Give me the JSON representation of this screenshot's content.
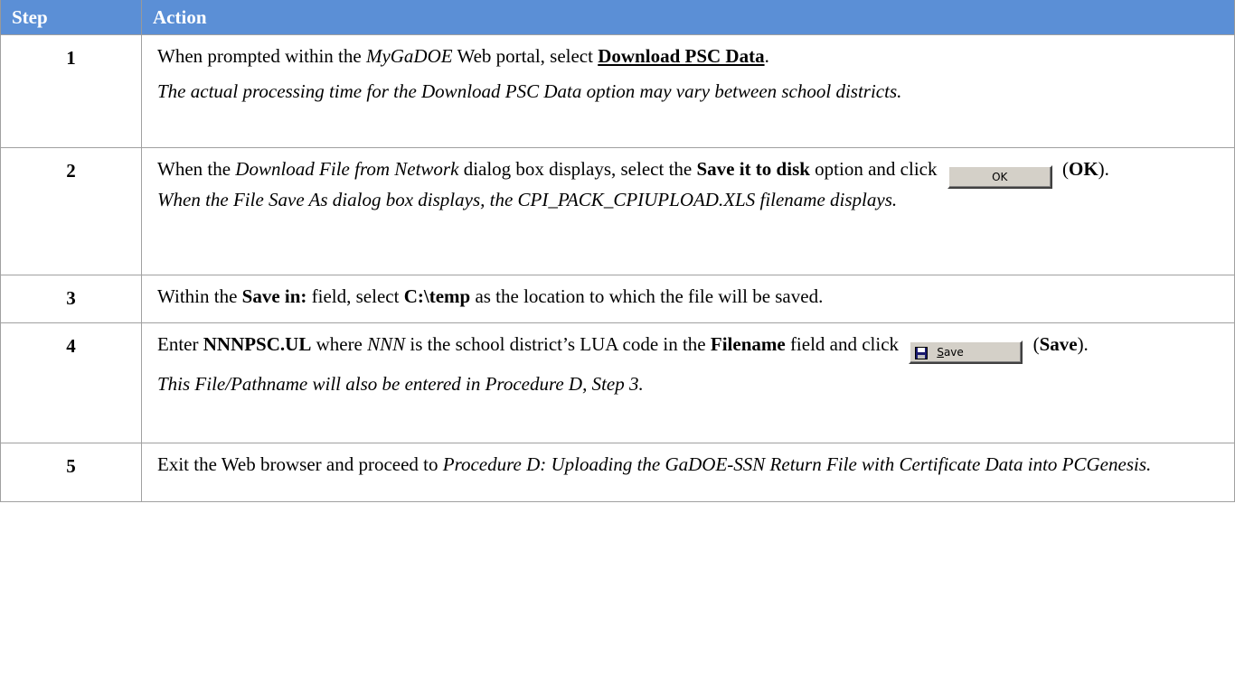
{
  "header": {
    "step": "Step",
    "action": "Action"
  },
  "rows": [
    {
      "num": "1",
      "line1": {
        "a": "When prompted within the ",
        "b": "MyGaDOE",
        "c": " Web portal, select ",
        "d": "Download PSC Data",
        "e": "."
      },
      "note": "The actual processing time for the Download PSC Data option may vary between school districts."
    },
    {
      "num": "2",
      "line1": {
        "a": "When the ",
        "b": "Download File from Network",
        "c": " dialog box displays, select the ",
        "d": "Save it to disk",
        "e": " option and click ",
        "btn": "OK",
        "f": " (",
        "g": "OK",
        "h": ")."
      },
      "note": "When the File Save As dialog box displays, the CPI_PACK_CPIUPLOAD.XLS filename displays."
    },
    {
      "num": "3",
      "line1": {
        "a": "Within the ",
        "b": "Save in:",
        "c": " field, select ",
        "d": "C:\\temp",
        "e": " as the location to which the file will be saved."
      }
    },
    {
      "num": "4",
      "line1": {
        "a": "NNNPSC.UL",
        "b": " where ",
        "c": "NNN",
        "d": " is the school district’s LUA code in the ",
        "e": "Filename",
        "f": " field and click ",
        "btn_s": "S",
        "btn_rest": "ave",
        "g": " (",
        "h": "Save",
        "i": ").",
        "pre": "Enter "
      },
      "note": "This File/Pathname will also be entered in Procedure D, Step 3."
    },
    {
      "num": "5",
      "line1": {
        "a": "Exit the Web browser and proceed to ",
        "b": "Procedure D:  Uploading the GaDOE-SSN Return File with Certificate Data into PCGenesis."
      }
    }
  ],
  "icons": {
    "save_button_icon": "floppy-disk-icon"
  }
}
